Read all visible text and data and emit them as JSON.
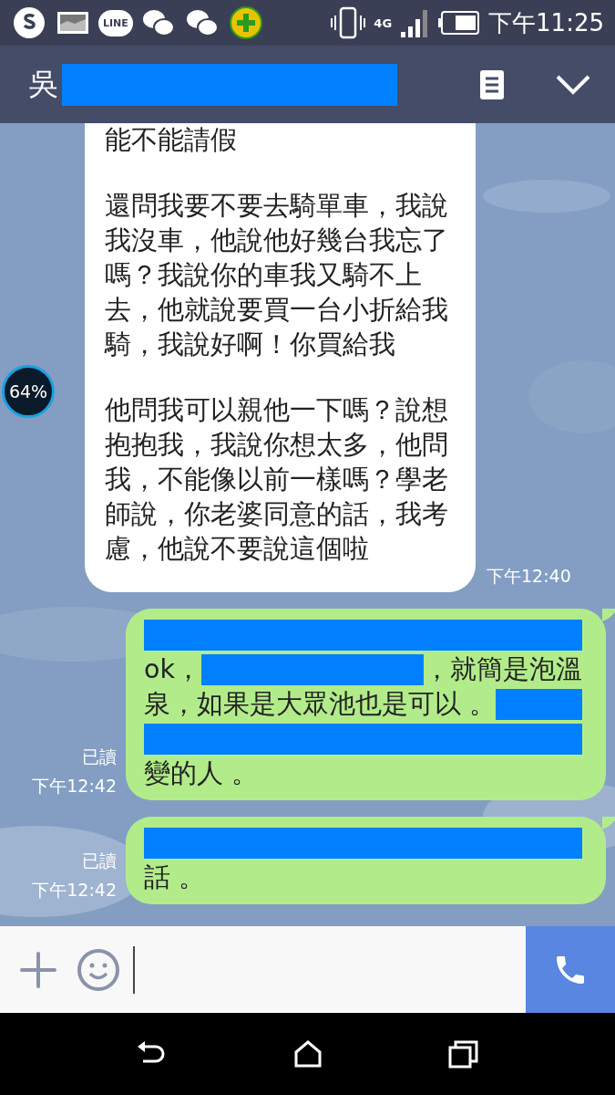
{
  "status_bar": {
    "notification_icons": [
      {
        "kind": "skype"
      },
      {
        "kind": "gallery"
      },
      {
        "kind": "line",
        "text": "LINE"
      },
      {
        "kind": "wechat"
      },
      {
        "kind": "wechat"
      },
      {
        "kind": "plus"
      }
    ],
    "network": "4G",
    "time": "下午11:25"
  },
  "header": {
    "title": "吳",
    "redacted": true
  },
  "floating_widget": {
    "text": "64%"
  },
  "messages": [
    {
      "kind": "incoming",
      "time": "下午12:40",
      "paragraphs": [
        [
          "能不能請假"
        ],
        [
          "還問我要不要去騎單車，我說",
          "我沒車，他說他好幾台我忘了",
          "嗎？我說你的車我又騎不上",
          "去，他就說要買一台小折給我",
          "騎，我說好啊！你買給我"
        ],
        [
          "他問我可以親他一下嗎？說想",
          "抱抱我，我說你想太多，他問",
          "我，不能像以前一樣嗎？學老",
          "師說，你老婆同意的話，我考",
          "慮，他說不要說這個啦"
        ]
      ]
    },
    {
      "kind": "outgoing",
      "read": "已讀",
      "time": "下午12:42",
      "lines": [
        [
          {
            "kind": "redaction"
          }
        ],
        [
          {
            "kind": "text",
            "text": "ok，"
          },
          {
            "kind": "redaction"
          },
          {
            "kind": "text",
            "text": "，就簡是泡溫"
          }
        ],
        [
          {
            "kind": "text",
            "text": "泉，如果是大眾池也是可以 。"
          },
          {
            "kind": "redaction"
          }
        ],
        [
          {
            "kind": "redaction"
          }
        ],
        [
          {
            "kind": "text",
            "text": "變的人 。"
          }
        ]
      ]
    },
    {
      "kind": "outgoing",
      "read": "已讀",
      "time": "下午12:42",
      "lines": [
        [
          {
            "kind": "redaction"
          }
        ],
        [
          {
            "kind": "text",
            "text": "話 。"
          }
        ]
      ]
    }
  ],
  "composer": {
    "caret": true
  }
}
